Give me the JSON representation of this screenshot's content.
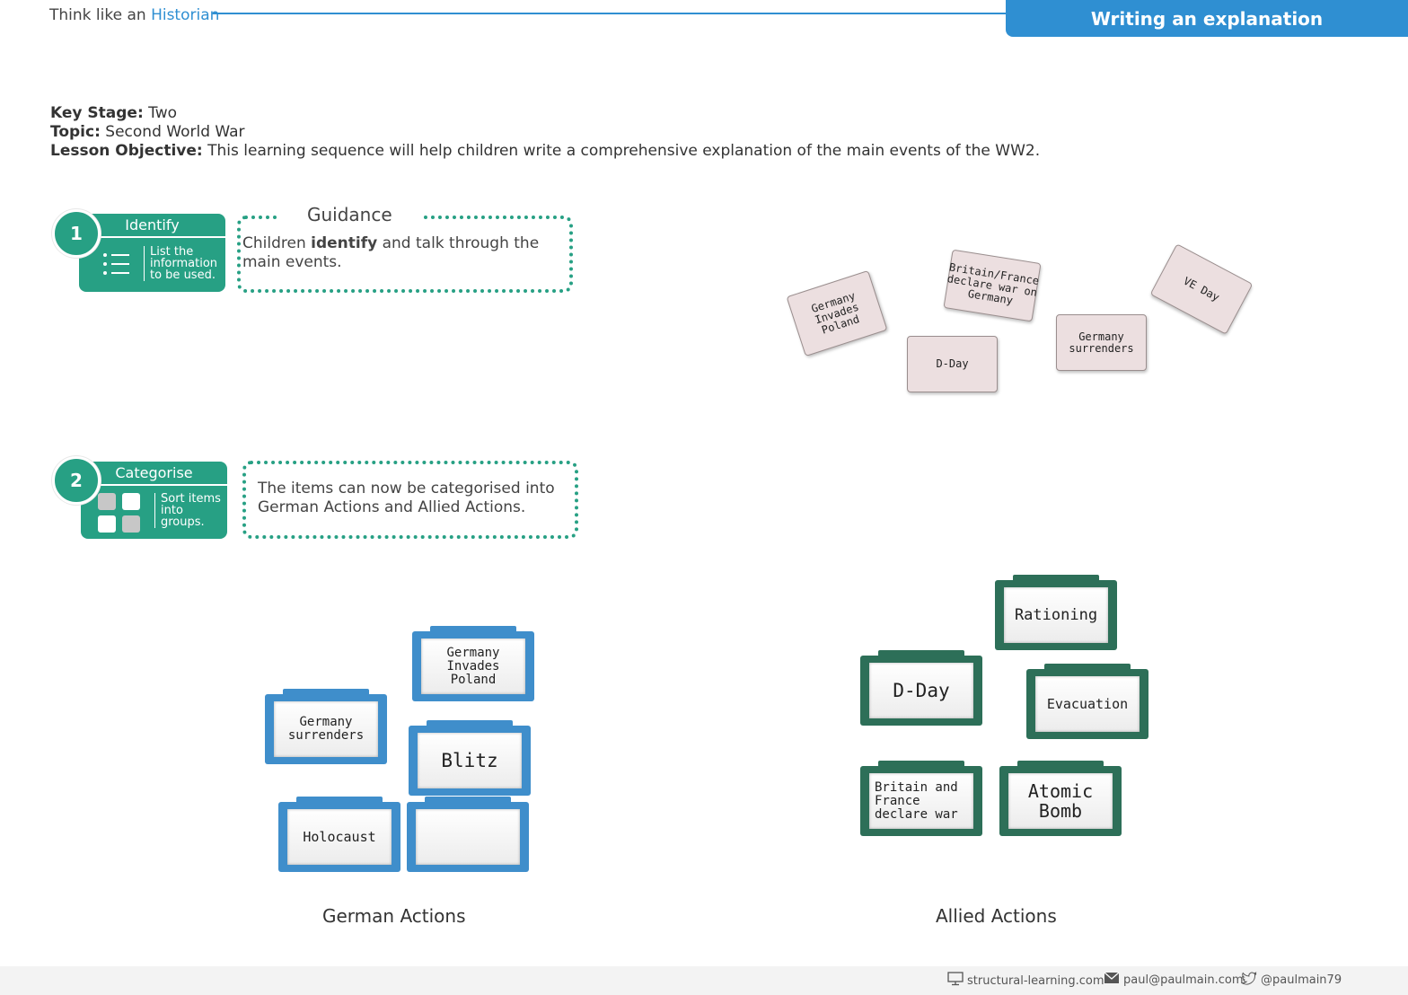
{
  "header": {
    "title_prefix": "Think like an ",
    "title_accent": "Historian",
    "banner": "Writing an explanation"
  },
  "meta": {
    "key_stage_label": "Key Stage:",
    "key_stage_value": " Two",
    "topic_label": "Topic:",
    "topic_value": " Second World War",
    "objective_label": "Lesson Objective:",
    "objective_value": " This learning sequence will help children write a comprehensive explanation of the main events of the WW2."
  },
  "steps": [
    {
      "number": "1",
      "name": "Identify",
      "description": "List the\ninformation\nto be used.",
      "icon": "list-icon",
      "guidance_title": "Guidance",
      "guidance_pre": "Children ",
      "guidance_bold": "identify",
      "guidance_post": " and talk through the main events."
    },
    {
      "number": "2",
      "name": "Categorise",
      "description": "Sort items\ninto\ngroups.",
      "icon": "grid-icon",
      "guidance_text": "The items can now be categorised into German Actions and Allied Actions."
    }
  ],
  "event_cards": [
    "Germany\nInvades\nPoland",
    "Britain/France\ndeclare war on\nGermany",
    "VE Day",
    "D-Day",
    "Germany\nsurrenders"
  ],
  "german_actions": {
    "label": "German Actions",
    "cards": [
      "Germany\nInvades\nPoland",
      "Germany\nsurrenders",
      "Blitz",
      "Holocaust",
      ""
    ]
  },
  "allied_actions": {
    "label": "Allied Actions",
    "cards": [
      "Rationing",
      "D-Day",
      "Evacuation",
      "Britain and\nFrance\ndeclare war",
      "Atomic\nBomb"
    ]
  },
  "footer": {
    "website": "structural-learning.com",
    "email": "paul@paulmain.com",
    "twitter": "@paulmain79"
  },
  "colors": {
    "blue": "#2f8fd2",
    "teal": "#27a084",
    "frame_blue": "#3f8ecb",
    "frame_green": "#2d6f58"
  }
}
